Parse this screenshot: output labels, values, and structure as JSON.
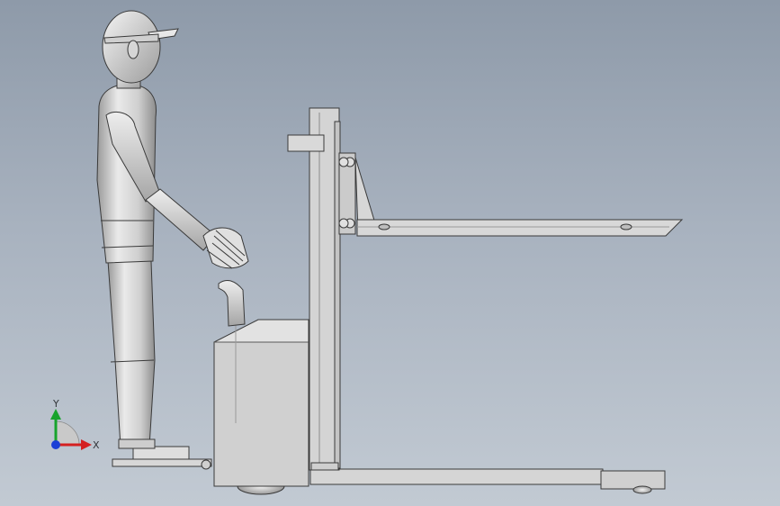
{
  "triad": {
    "x_label": "X",
    "y_label": "Y",
    "x_color": "#d42020",
    "y_color": "#17a32c",
    "z_color": "#1b3fd6"
  },
  "scene": {
    "background_top": "#8e9aa9",
    "background_bottom": "#c2cad3",
    "part_fill": "#d2d2d2",
    "edge_color": "#3a3a3a"
  }
}
